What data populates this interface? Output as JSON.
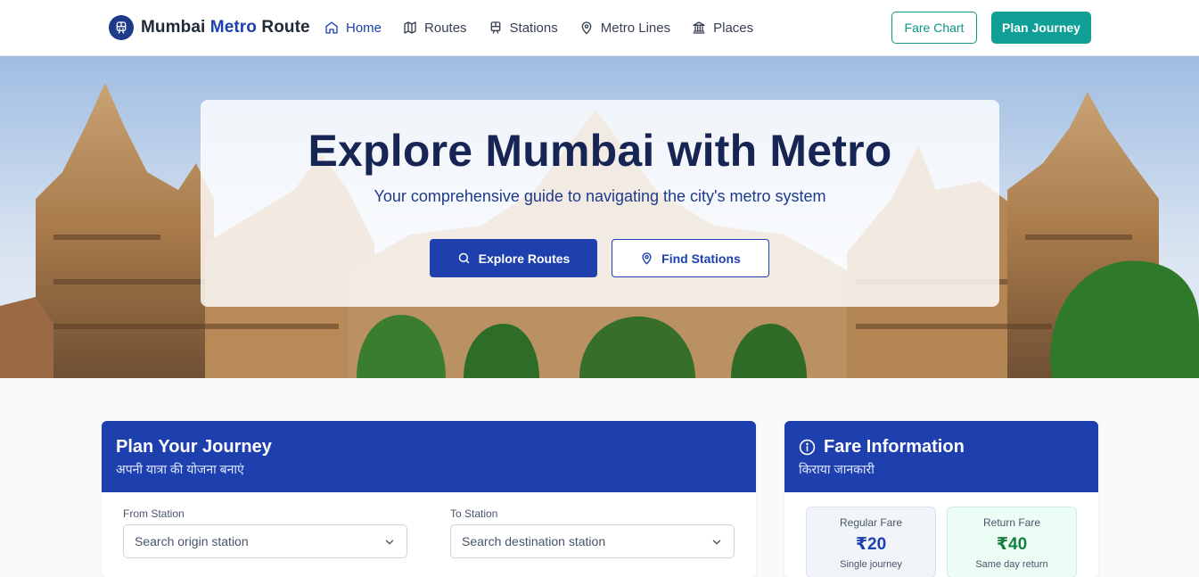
{
  "brand": {
    "part1": "Mumbai ",
    "part2": "Metro",
    "part3": " Route",
    "logo_icon": "train-icon"
  },
  "nav": {
    "items": [
      {
        "label": "Home",
        "icon": "home-icon",
        "active": true
      },
      {
        "label": "Routes",
        "icon": "map-icon",
        "active": false
      },
      {
        "label": "Stations",
        "icon": "train-icon",
        "active": false
      },
      {
        "label": "Metro Lines",
        "icon": "map-pin-icon",
        "active": false
      },
      {
        "label": "Places",
        "icon": "landmark-icon",
        "active": false
      }
    ],
    "fare_chart_label": "Fare Chart",
    "plan_journey_label": "Plan Journey"
  },
  "hero": {
    "title": "Explore Mumbai with Metro",
    "subtitle": "Your comprehensive guide to navigating the city's metro system",
    "explore_routes_label": "Explore Routes",
    "find_stations_label": "Find Stations"
  },
  "journey": {
    "title": "Plan Your Journey",
    "subtitle": "अपनी यात्रा की योजना बनाएं",
    "from_label": "From Station",
    "from_placeholder": "Search origin station",
    "to_label": "To Station",
    "to_placeholder": "Search destination station"
  },
  "fare": {
    "title": "Fare Information",
    "subtitle": "किराया जानकारी",
    "regular": {
      "label": "Regular Fare",
      "amount": "₹20",
      "note": "Single journey"
    },
    "return": {
      "label": "Return Fare",
      "amount": "₹40",
      "note": "Same day return"
    }
  },
  "colors": {
    "primary": "#1e40af",
    "teal": "#0d9488",
    "dark_title": "#172554"
  }
}
